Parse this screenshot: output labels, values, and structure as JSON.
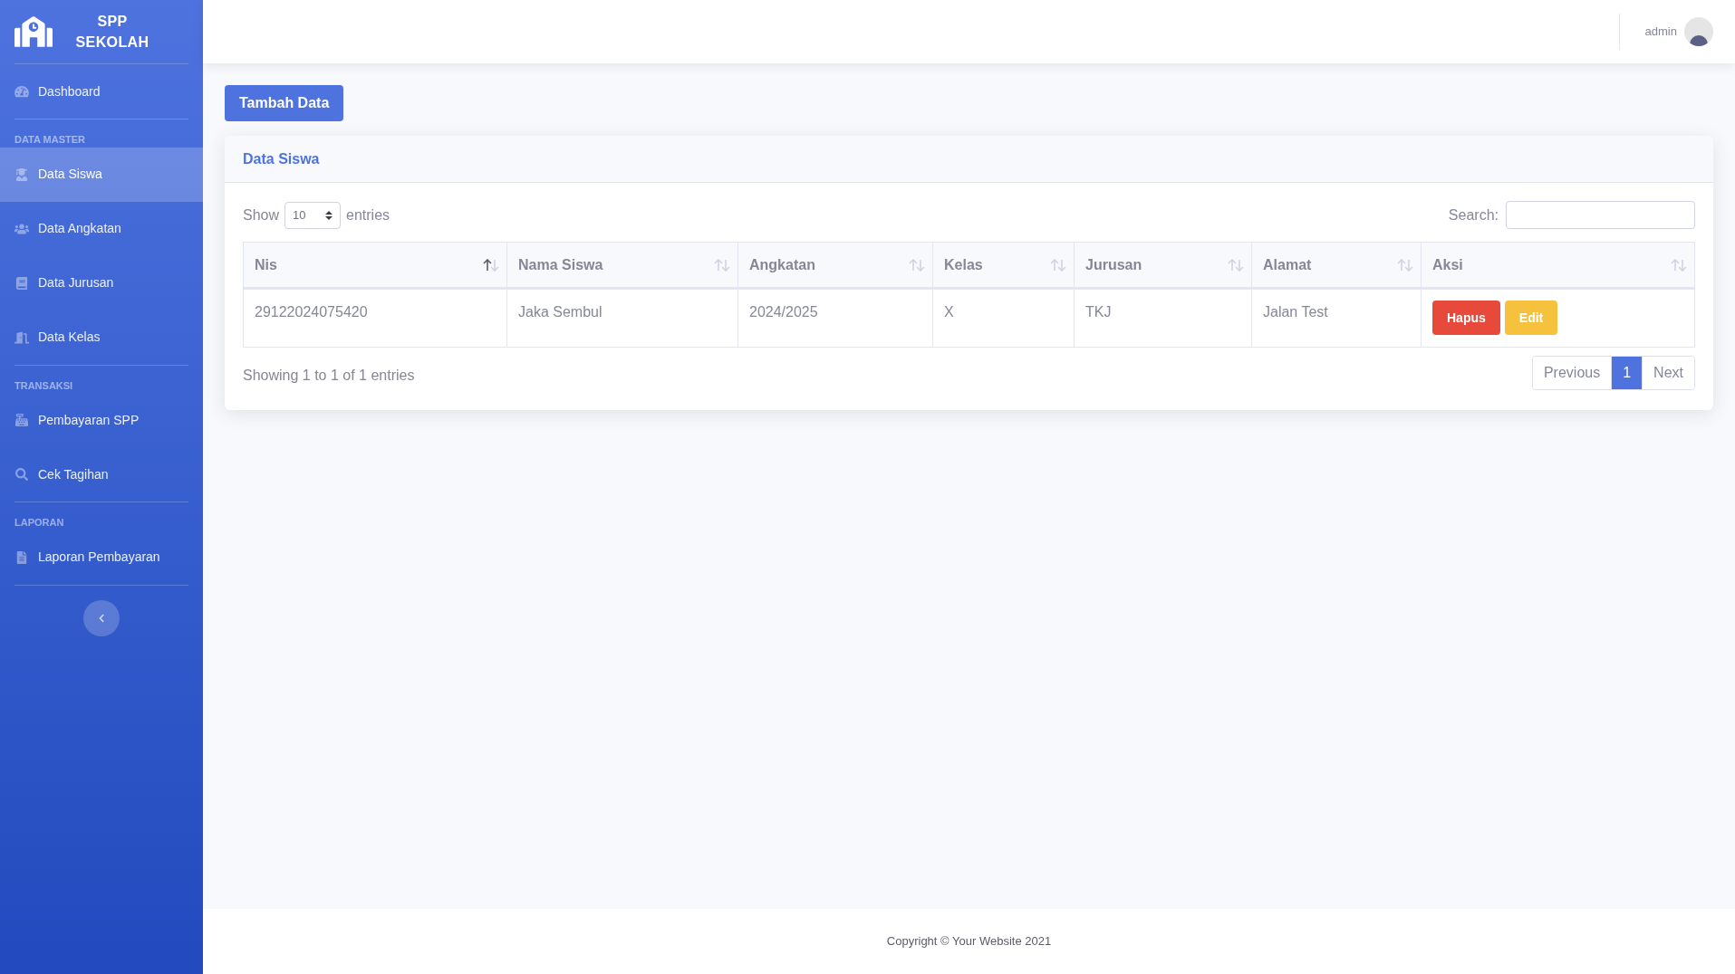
{
  "sidebar": {
    "brand": "SPP SEKOLAH",
    "sections": [
      {
        "items": [
          {
            "label": "Dashboard",
            "selected": false
          }
        ]
      },
      {
        "heading": "DATA MASTER",
        "items": [
          {
            "label": "Data Siswa",
            "selected": true
          },
          {
            "label": "Data Angkatan",
            "selected": false
          },
          {
            "label": "Data Jurusan",
            "selected": false
          },
          {
            "label": "Data Kelas",
            "selected": false
          }
        ]
      },
      {
        "heading": "TRANSAKSI",
        "items": [
          {
            "label": "Pembayaran SPP",
            "selected": false
          },
          {
            "label": "Cek Tagihan",
            "selected": false
          }
        ]
      },
      {
        "heading": "LAPORAN",
        "items": [
          {
            "label": "Laporan Pembayaran",
            "selected": false
          }
        ]
      }
    ]
  },
  "topbar": {
    "user": "admin"
  },
  "add_button": "Tambah Data",
  "card": {
    "title": "Data Siswa",
    "show_label": "Show",
    "page_size": "10",
    "entries_label": "entries",
    "search_label": "Search:",
    "table": {
      "columns": [
        {
          "label": "Nis",
          "sorted": true
        },
        {
          "label": "Nama Siswa",
          "sorted": false
        },
        {
          "label": "Angkatan",
          "sorted": false
        },
        {
          "label": "Kelas",
          "sorted": false
        },
        {
          "label": "Jurusan",
          "sorted": false
        },
        {
          "label": "Alamat",
          "sorted": false
        },
        {
          "label": "Aksi",
          "sorted": false
        }
      ],
      "rows": [
        {
          "cells": [
            "29122024075420",
            "Jaka Sembul",
            "2024/2025",
            "X",
            "TKJ",
            "Jalan Test"
          ],
          "actions": [
            {
              "label": "Hapus",
              "kind": "danger"
            },
            {
              "label": "Edit",
              "kind": "warning"
            }
          ]
        }
      ]
    },
    "info": "Showing 1 to 1 of 1 entries",
    "pagination": [
      {
        "label": "Previous",
        "selected": false
      },
      {
        "label": "1",
        "selected": true
      },
      {
        "label": "Next",
        "selected": false
      }
    ]
  },
  "footer": "Copyright © Your Website 2021"
}
